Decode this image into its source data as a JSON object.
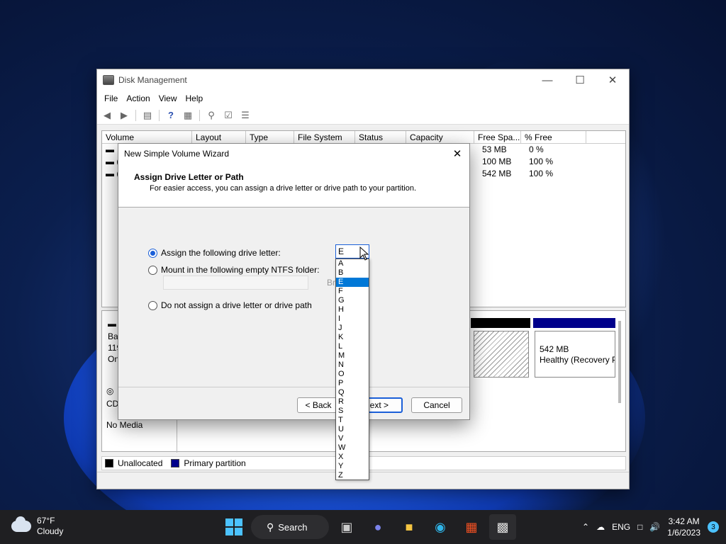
{
  "disk_management": {
    "title": "Disk Management",
    "menu": [
      "File",
      "Action",
      "View",
      "Help"
    ],
    "columns": [
      "Volume",
      "Layout",
      "Type",
      "File System",
      "Status",
      "Capacity",
      "Free Spa...",
      "% Free"
    ],
    "rows": [
      {
        "free": "53 MB",
        "pct": "0 %"
      },
      {
        "free": "100 MB",
        "pct": "100 %"
      },
      {
        "free": "542 MB",
        "pct": "100 %"
      }
    ],
    "disk0": {
      "label_lines": [
        "Bas",
        "119",
        "Onl"
      ]
    },
    "recovery": {
      "size": "542 MB",
      "status": "Healthy (Recovery P"
    },
    "cd": {
      "label": "CD",
      "media": "No Media"
    },
    "legend": {
      "unallocated": "Unallocated",
      "primary": "Primary partition"
    },
    "colors": {
      "unallocated": "#000000",
      "primary": "#00008b"
    }
  },
  "wizard": {
    "title": "New Simple Volume Wizard",
    "heading": "Assign Drive Letter or Path",
    "subheading": "For easier access, you can assign a drive letter or drive path to your partition.",
    "option_letter": "Assign the following drive letter:",
    "option_folder": "Mount in the following empty NTFS folder:",
    "option_none": "Do not assign a drive letter or drive path",
    "browse": "Bro",
    "back": "< Back",
    "next": "ext >",
    "cancel": "Cancel",
    "selected_letter": "E",
    "letters": [
      "A",
      "B",
      "E",
      "F",
      "G",
      "H",
      "I",
      "J",
      "K",
      "L",
      "M",
      "N",
      "O",
      "P",
      "Q",
      "R",
      "S",
      "T",
      "U",
      "V",
      "W",
      "X",
      "Y",
      "Z"
    ]
  },
  "taskbar": {
    "temperature": "67°F",
    "condition": "Cloudy",
    "search": "Search",
    "language": "ENG",
    "time": "3:42 AM",
    "date": "1/6/2023",
    "notifications": "3"
  }
}
